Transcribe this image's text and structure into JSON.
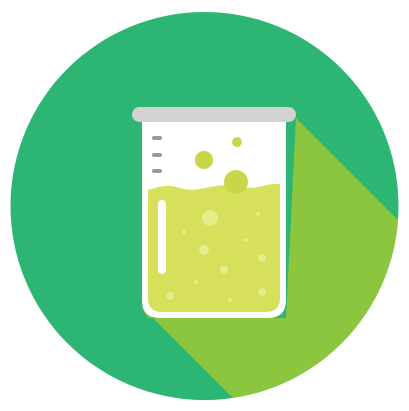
{
  "icon": {
    "name": "beaker-icon",
    "colors": {
      "circle": "#2DB673",
      "shadow": "#8CC63F",
      "rim": "#D3D3D3",
      "glass": "#FFFFFF",
      "liquid": "#D6E05A",
      "liquid_light": "#E6EC8A",
      "bubble": "#C9D64A",
      "tick": "#9A9A9A"
    }
  }
}
